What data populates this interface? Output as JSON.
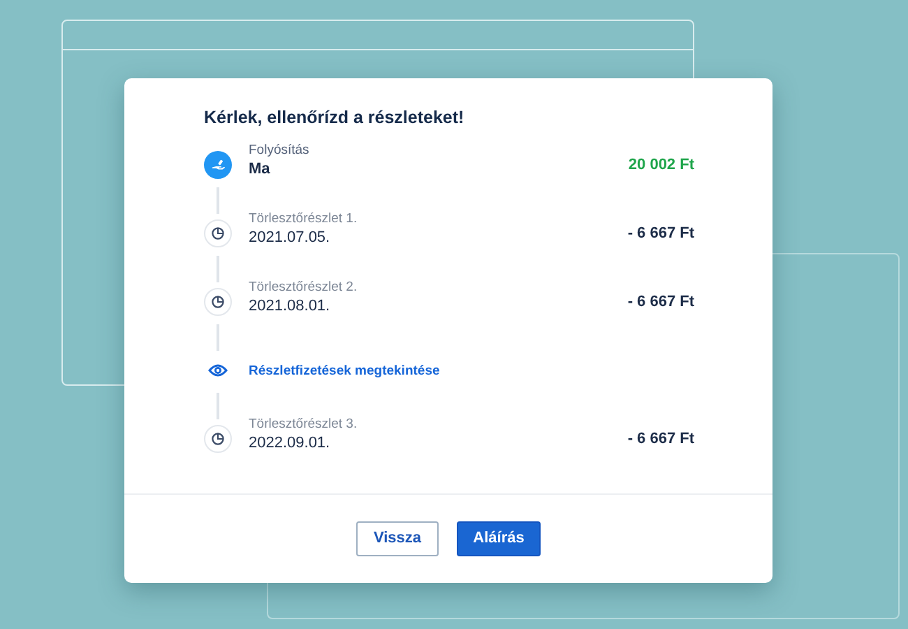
{
  "dialog": {
    "title": "Kérlek, ellenőrízd a részleteket!",
    "items": [
      {
        "kind": "disbursement",
        "label": "Folyósítás",
        "value": "Ma",
        "amount": "20 002 Ft"
      },
      {
        "kind": "installment",
        "label": "Törlesztőrészlet 1.",
        "value": "2021.07.05.",
        "amount": "- 6 667 Ft"
      },
      {
        "kind": "installment",
        "label": "Törlesztőrészlet 2.",
        "value": "2021.08.01.",
        "amount": "- 6 667 Ft"
      },
      {
        "kind": "link",
        "label": "Részletfizetések megtekintése"
      },
      {
        "kind": "installment",
        "label": "Törlesztőrészlet 3.",
        "value": "2022.09.01.",
        "amount": "- 6 667 Ft"
      }
    ],
    "buttons": [
      {
        "kind": "secondary",
        "label": "Vissza"
      },
      {
        "kind": "primary",
        "label": "Aláírás"
      }
    ]
  }
}
